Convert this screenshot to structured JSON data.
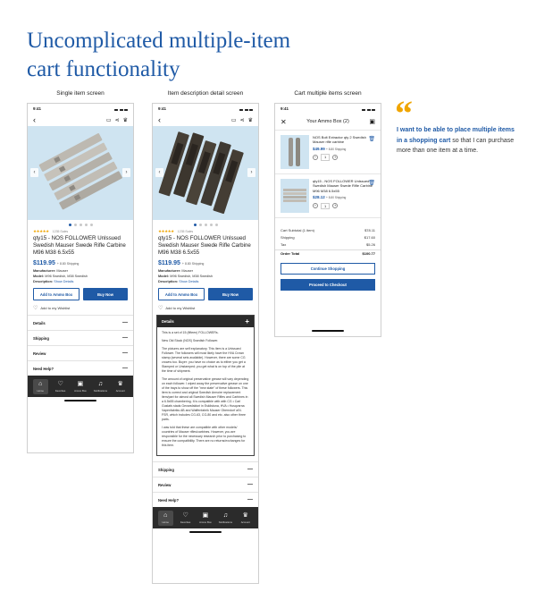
{
  "headline": {
    "line1": "Uncomplicated multiple-item",
    "line2": "cart functionality"
  },
  "labels": {
    "single": "Single item screen",
    "detail": "Item description detail screen",
    "cart": "Cart multiple items screen"
  },
  "status": {
    "time": "9:41"
  },
  "product": {
    "reviews": "1235 Sales",
    "title": "qty15 - NOS FOLLOWER Unlssued Swedish Mauser Swede Rifle Carbine M96 M38 6.5x55",
    "price": "$119.95",
    "shipping": "+ 8.80 Shipping",
    "manufacturer_label": "Manufacturer:",
    "manufacturer": "Mauser",
    "model_label": "Model:",
    "model": "M96 Swedish, M38 Swedish",
    "description_label": "Description:",
    "description_link": "Show Details",
    "add_to_box": "Add to Ammo Box",
    "buy_now": "Buy Now",
    "wishlist": "Add to my Wishlist",
    "image_colors": {
      "background": "#cfe4f1",
      "metal": "#b8b4ad",
      "dark_metal": "#3f3a33"
    }
  },
  "accordion": {
    "details": "Details",
    "shipping": "Shipping",
    "review": "Review",
    "need_help": "Need Help?"
  },
  "tabs": [
    {
      "label": "Home",
      "icon": "home-icon"
    },
    {
      "label": "Favorites",
      "icon": "heart-icon"
    },
    {
      "label": "Ammo Box",
      "icon": "box-icon"
    },
    {
      "label": "Notifications",
      "icon": "bell-icon"
    },
    {
      "label": "Account",
      "icon": "crown-icon"
    }
  ],
  "details": {
    "p1": "This is a set of 15 (fifteen) FOLLOWERs.",
    "p2": "New Old Stock (NOS) Swedish Follower.",
    "p3": "The pictures are self explanatory. This item is a Unissued Follower. The followers will most likely have the HVA Crown stamp (several sets available). However, there are some CG crowns too. Buyer: you have no choice as to either you get a Stamped or Unstamped; you get what is on top of the pile at the time of shipment.",
    "p4": "The amount of original preservative grease will vary depending on each follower. I wiped away the preservative grease on one of the trays to show off the \"new state\" of these followers. This item is correct and original Swedish Armoire replacement item/part for almost all Swedish Mauser Rifles and Carbines in a 6.5x55 chambering. It is compatible with with CG • Carl Gustafs stads Gevarsfaktori in Eskilstuna, HVA • Husqvarna Vapenfabriks AB and Waffenfabrik Mauser Oberndorf a/N. FSR, which includes CG-63, CG-80 and etc. also other three parts.",
    "p5": "I was told that these are compatible with other models/ countries of Mauser rifles/carbines. However, you are responsible for the necessary research prior to purchasing to ensure the compatibility. There are no returns/exchanges for this item."
  },
  "cart": {
    "title": "Your Ammo Box (2)",
    "items": [
      {
        "desc": "NOS Bolt Extractor qty 2 Swedish Mauser rifle carbine",
        "price": "$49.99",
        "shipping": "+ 8.80 Shipping",
        "qty": "1"
      },
      {
        "desc": "qty15 - NOS FOLLOWER Unlssued Swedish Mauser Swede Rifle Carbine M96 M38 6.5x55",
        "price": "$28.12",
        "shipping": "+ 8.80 Shipping",
        "qty": "1"
      }
    ],
    "subtotal_label": "Cart Subtotal (1 item)",
    "subtotal": "$78.11",
    "shipping_label": "Shipping",
    "shipping": "$17.60",
    "tax_label": "Tax",
    "tax": "$5.26",
    "total_label": "Order Total",
    "total": "$100.77",
    "continue": "Continue Shopping",
    "checkout": "Proceed to Checkout"
  },
  "quote": {
    "highlight": "I want to be able to place multiple items in a shopping cart",
    "rest": " so that I can purchase more than one item at a time."
  },
  "colors": {
    "brand_blue": "#1f5aa6",
    "accent_gold": "#f0a500",
    "tabbar_dark": "#2b2b2b"
  }
}
